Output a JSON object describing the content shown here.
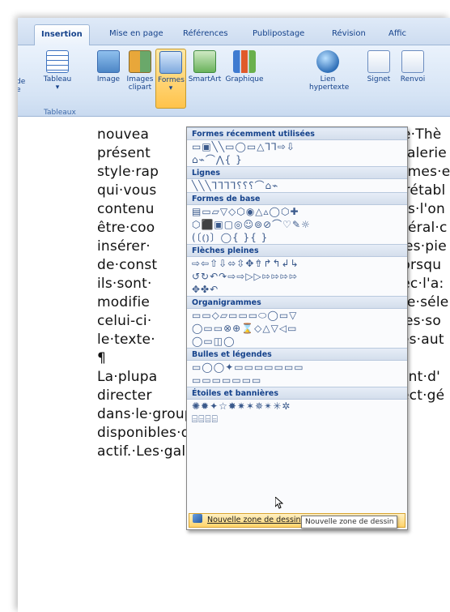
{
  "tabs": [
    "Insertion",
    "Mise en page",
    "Références",
    "Publipostage",
    "Révision",
    "Affic"
  ],
  "ribbon": {
    "left_labels": [
      "de",
      "e"
    ],
    "tableau": "Tableau",
    "image": "Image",
    "images_clipart": [
      "Images",
      "clipart"
    ],
    "formes": "Formes",
    "smartart": "SmartArt",
    "graphique": "Graphique",
    "lien": [
      "Lien",
      "hypertexte"
    ],
    "signet": "Signet",
    "renvoi": "Renvoi",
    "group_tableaux": "Tableaux"
  },
  "document": {
    "lines": [
      {
        "left": "nouvea",
        "right": "pe·Thè"
      },
      {
        "left": "présent",
        "right": "galerie"
      },
      {
        "left": "style·rap",
        "right": "èmes·e"
      },
      {
        "left": "qui·vous",
        "right": "·rétabl"
      },
      {
        "left": "contenu",
        "right": "us·l'on"
      },
      {
        "left": "être·coo",
        "right": "néral·c"
      },
      {
        "left": "insérer·",
        "right": "des·pie"
      },
      {
        "left": "de·const",
        "right": "Lorsqu"
      },
      {
        "left": "ils·sont·",
        "right": "vec·l'a:"
      },
      {
        "left": "modifie",
        "right": "te·séle"
      },
      {
        "left": "celui-ci·",
        "right": "des·so"
      },
      {
        "left": "le·texte·",
        "right": "les·aut"
      },
      {
        "left": "¶",
        "right": ""
      },
      {
        "left": "La·plupa",
        "right": "ent·d'"
      },
      {
        "left": "directer",
        "right": "ect·gé"
      },
      {
        "left": "dans·le·groupe·Thèmes·sous·l'onglet·M",
        "right": ""
      },
      {
        "left": "disponibles·dans·la·galerie·Styles·rap",
        "right": ""
      },
      {
        "left": "actif.·Les·galeries·Thèmes·et·Styles·rap",
        "right": ""
      }
    ]
  },
  "gallery": {
    "sections": [
      {
        "title": "Formes récemment utilisées",
        "rows": [
          "▭▣╲╲▭◯▭△⅂⅂⇨⇩",
          "⌂⌁⌒⋀{ }"
        ]
      },
      {
        "title": "Lignes",
        "rows": [
          "╲╲╲⅂⅂⅂⅂⸮⸮⸮⌒⌂⌁"
        ]
      },
      {
        "title": "Formes de base",
        "rows": [
          "▤▭▱▽◇⬡◉△▵◯⬡✚",
          "⬡⬛▣▢◎☺⊚⊘⌒♡✎☼",
          "(〔⦅⦆〕◯{ }{ }"
        ]
      },
      {
        "title": "Flèches pleines",
        "rows": [
          "⇨⇦⇧⇩⬄⇳✥⇮↱↰↲↳",
          "↺↻↶↷⇨⇨▷▷⇰⇰⇰⇰",
          "✥✤↶"
        ]
      },
      {
        "title": "Organigrammes",
        "rows": [
          "▭▭◇▱▭▭▭⬭◯▭▽",
          "◯▭▭⊗⊕⌛◇△▽◁▭",
          "◯▭◫◯"
        ]
      },
      {
        "title": "Bulles et légendes",
        "rows": [
          "▭◯◯✦▭▭▭▭▭▭▭",
          "▭▭▭▭▭▭▭"
        ]
      },
      {
        "title": "Étoiles et bannières",
        "rows": [
          "✺✹✦☆✸✷✶✵✴✳✲",
          "⌸⌸⌸⌸"
        ]
      }
    ],
    "new_canvas": "Nouvelle zone de dessin",
    "tooltip": "Nouvelle zone de dessin"
  }
}
